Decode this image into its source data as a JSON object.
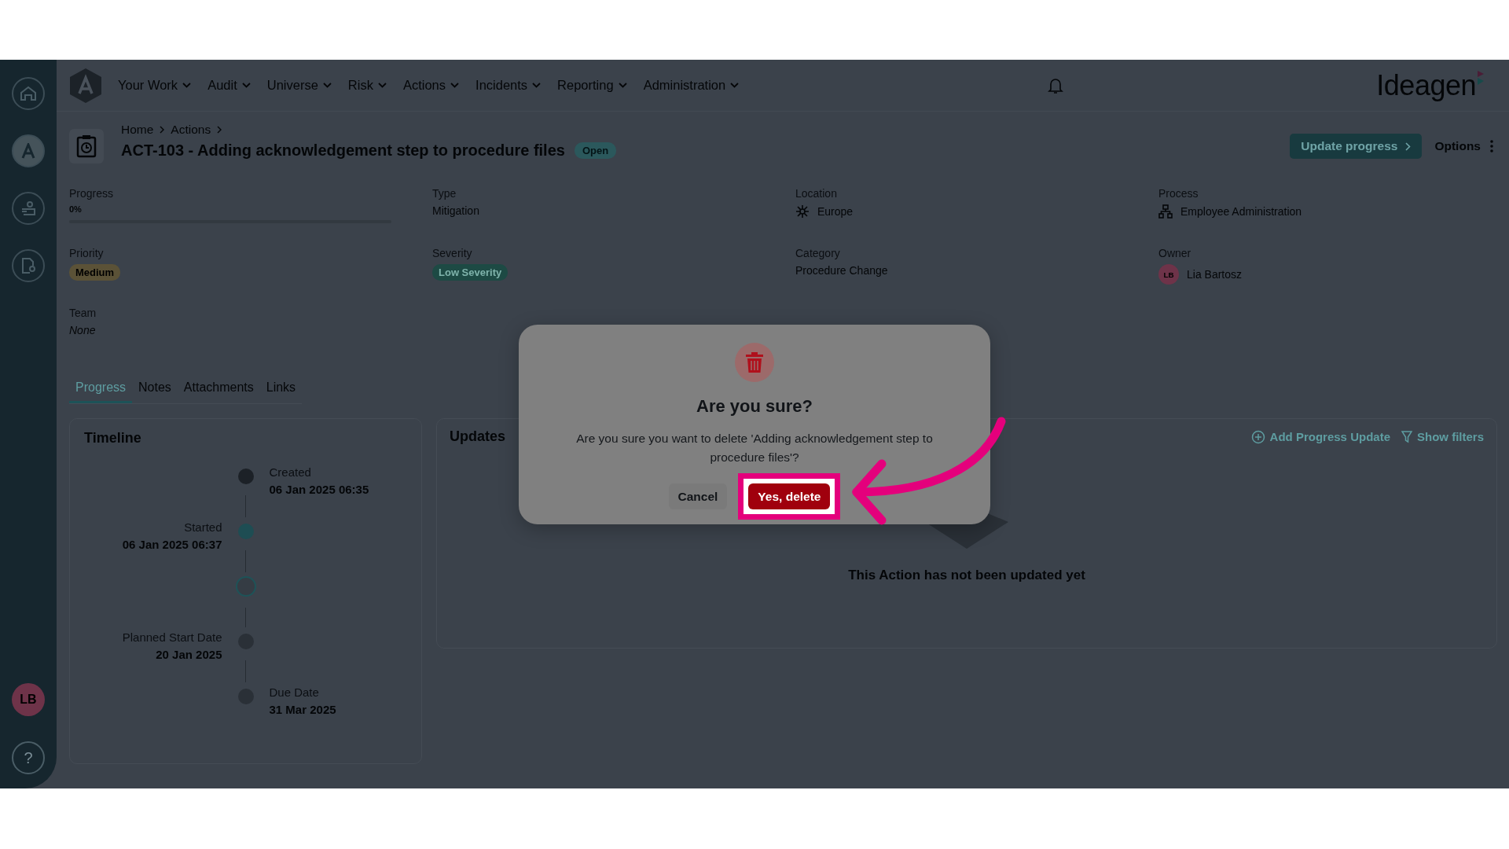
{
  "sidebar": {
    "items": [
      {
        "kind": "home",
        "selected": false
      },
      {
        "kind": "logo",
        "selected": true
      },
      {
        "kind": "people",
        "selected": false
      },
      {
        "kind": "document",
        "selected": false
      }
    ],
    "user": "LB",
    "help": "?"
  },
  "nav": {
    "items": [
      "Your Work",
      "Audit",
      "Universe",
      "Risk",
      "Actions",
      "Incidents",
      "Reporting",
      "Administration"
    ],
    "brand": "Ideagen"
  },
  "header": {
    "breadcrumb": [
      "Home",
      "Actions"
    ],
    "title": "ACT-103 - Adding acknowledgement step to procedure files",
    "status": "Open",
    "primary_action": "Update progress",
    "secondary_action": "Options"
  },
  "fields": [
    {
      "label": "Progress",
      "kind": "progress",
      "value": "0%",
      "level": 0
    },
    {
      "label": "Type",
      "kind": "text",
      "value": "Mitigation"
    },
    {
      "label": "Location",
      "kind": "location",
      "value": "Europe"
    },
    {
      "label": "Process",
      "kind": "process",
      "value": "Employee Administration"
    },
    {
      "label": "Priority",
      "kind": "badge",
      "value": "Medium",
      "color": "#5b5237"
    },
    {
      "label": "Severity",
      "kind": "badge",
      "value": "Low Severity",
      "color": "#1d4a44"
    },
    {
      "label": "Category",
      "kind": "text",
      "value": "Procedure Change"
    },
    {
      "label": "Owner",
      "kind": "person",
      "value": "Lia Bartosz",
      "initials": "LB"
    },
    {
      "label": "Team",
      "kind": "empty",
      "value": "None"
    }
  ],
  "tabs": [
    {
      "label": "Progress",
      "selected": true
    },
    {
      "label": "Notes",
      "selected": false
    },
    {
      "label": "Attachments",
      "selected": false
    },
    {
      "label": "Links",
      "selected": false
    }
  ],
  "timeline": {
    "title": "Timeline",
    "events": [
      {
        "kind": "done",
        "label": "Created",
        "date": "06 Jan 2025 06:35"
      },
      {
        "kind": "active",
        "label": "Started",
        "date": "06 Jan 2025 06:37"
      },
      {
        "kind": "current"
      },
      {
        "kind": "pending",
        "label": "Planned Start Date",
        "date": "20 Jan 2025"
      },
      {
        "kind": "pending",
        "label": "Due Date",
        "date": "31 Mar 2025"
      }
    ]
  },
  "updates": {
    "title": "Updates",
    "add_action": "Add Progress Update",
    "filter_action": "Show filters",
    "empty_text": "This Action has not been updated yet"
  },
  "dialog": {
    "title": "Are you sure?",
    "message": "Are you sure you want to delete 'Adding acknowledgement step to procedure files'?",
    "buttons": [
      {
        "label": "Cancel",
        "kind": "secondary",
        "highlighted": false
      },
      {
        "label": "Yes, delete",
        "kind": "danger",
        "highlighted": true
      }
    ]
  }
}
